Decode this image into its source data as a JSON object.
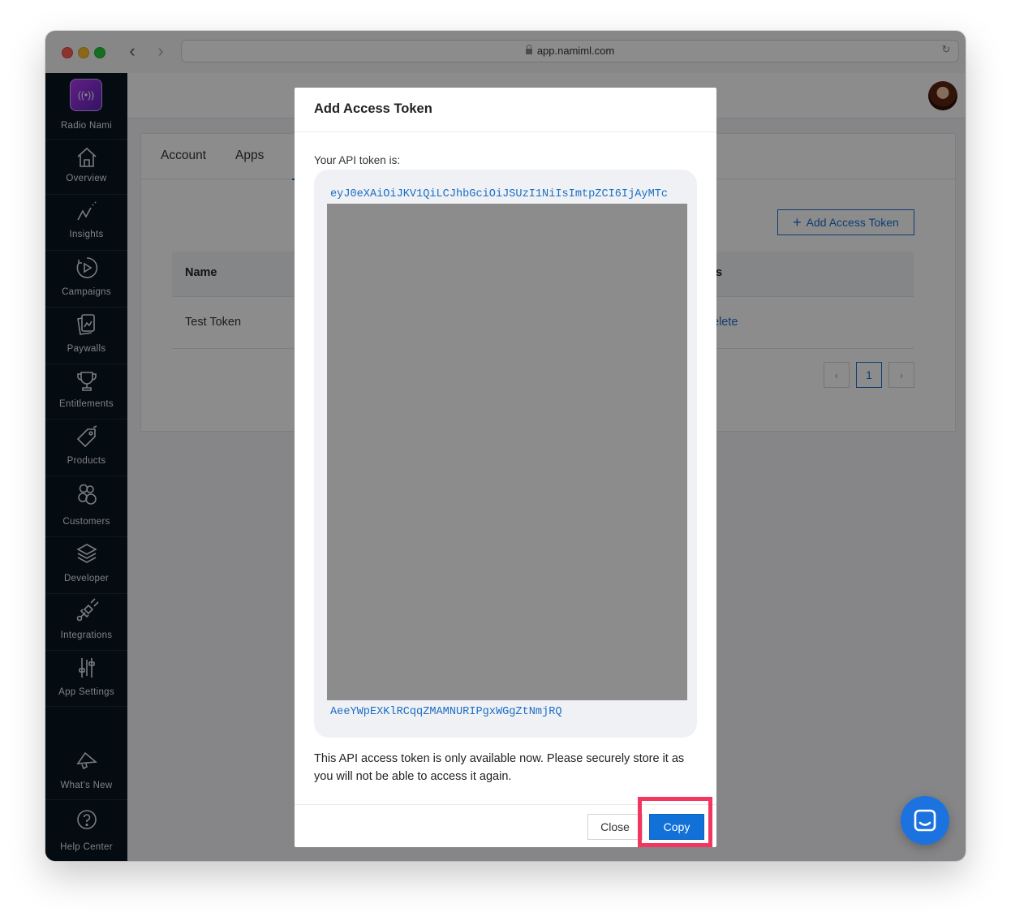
{
  "browser": {
    "url": "app.namiml.com"
  },
  "sidebar": {
    "brand": "Radio Nami",
    "items": [
      {
        "label": "Overview",
        "icon": "home-icon"
      },
      {
        "label": "Insights",
        "icon": "chart-line-icon"
      },
      {
        "label": "Campaigns",
        "icon": "campaign-play-icon"
      },
      {
        "label": "Paywalls",
        "icon": "paywall-cards-icon"
      },
      {
        "label": "Entitlements",
        "icon": "trophy-icon"
      },
      {
        "label": "Products",
        "icon": "tag-icon"
      },
      {
        "label": "Customers",
        "icon": "customers-icon"
      },
      {
        "label": "Developer",
        "icon": "layers-icon"
      },
      {
        "label": "Integrations",
        "icon": "plug-icon"
      },
      {
        "label": "App Settings",
        "icon": "sliders-icon"
      }
    ],
    "bottom_items": [
      {
        "label": "What's New",
        "icon": "megaphone-icon"
      },
      {
        "label": "Help Center",
        "icon": "help-icon"
      }
    ]
  },
  "page": {
    "tabs": [
      "Account",
      "Apps"
    ],
    "add_button": "Add Access Token",
    "table": {
      "headers": [
        "Name"
      ],
      "rows": [
        {
          "name": "Test Token",
          "action": "elete"
        }
      ]
    },
    "pagination": {
      "current": "1"
    }
  },
  "modal": {
    "title": "Add Access Token",
    "token_label": "Your API token is:",
    "token_first_line": "eyJ0eXAiOiJKV1QiLCJhbGciOiJSUzI1NiIsImtpZCI6IjAyMTc",
    "token_last_line": "AeeYWpEXKlRCqqZMAMNURIPgxWGgZtNmjRQ",
    "notice": "This API access token is only available now. Please securely store it as you will not be able to access it again.",
    "close_button": "Close",
    "copy_button": "Copy"
  },
  "colors": {
    "accent": "#1271d9",
    "highlight": "#f2365f",
    "sidebar": "#081420"
  }
}
